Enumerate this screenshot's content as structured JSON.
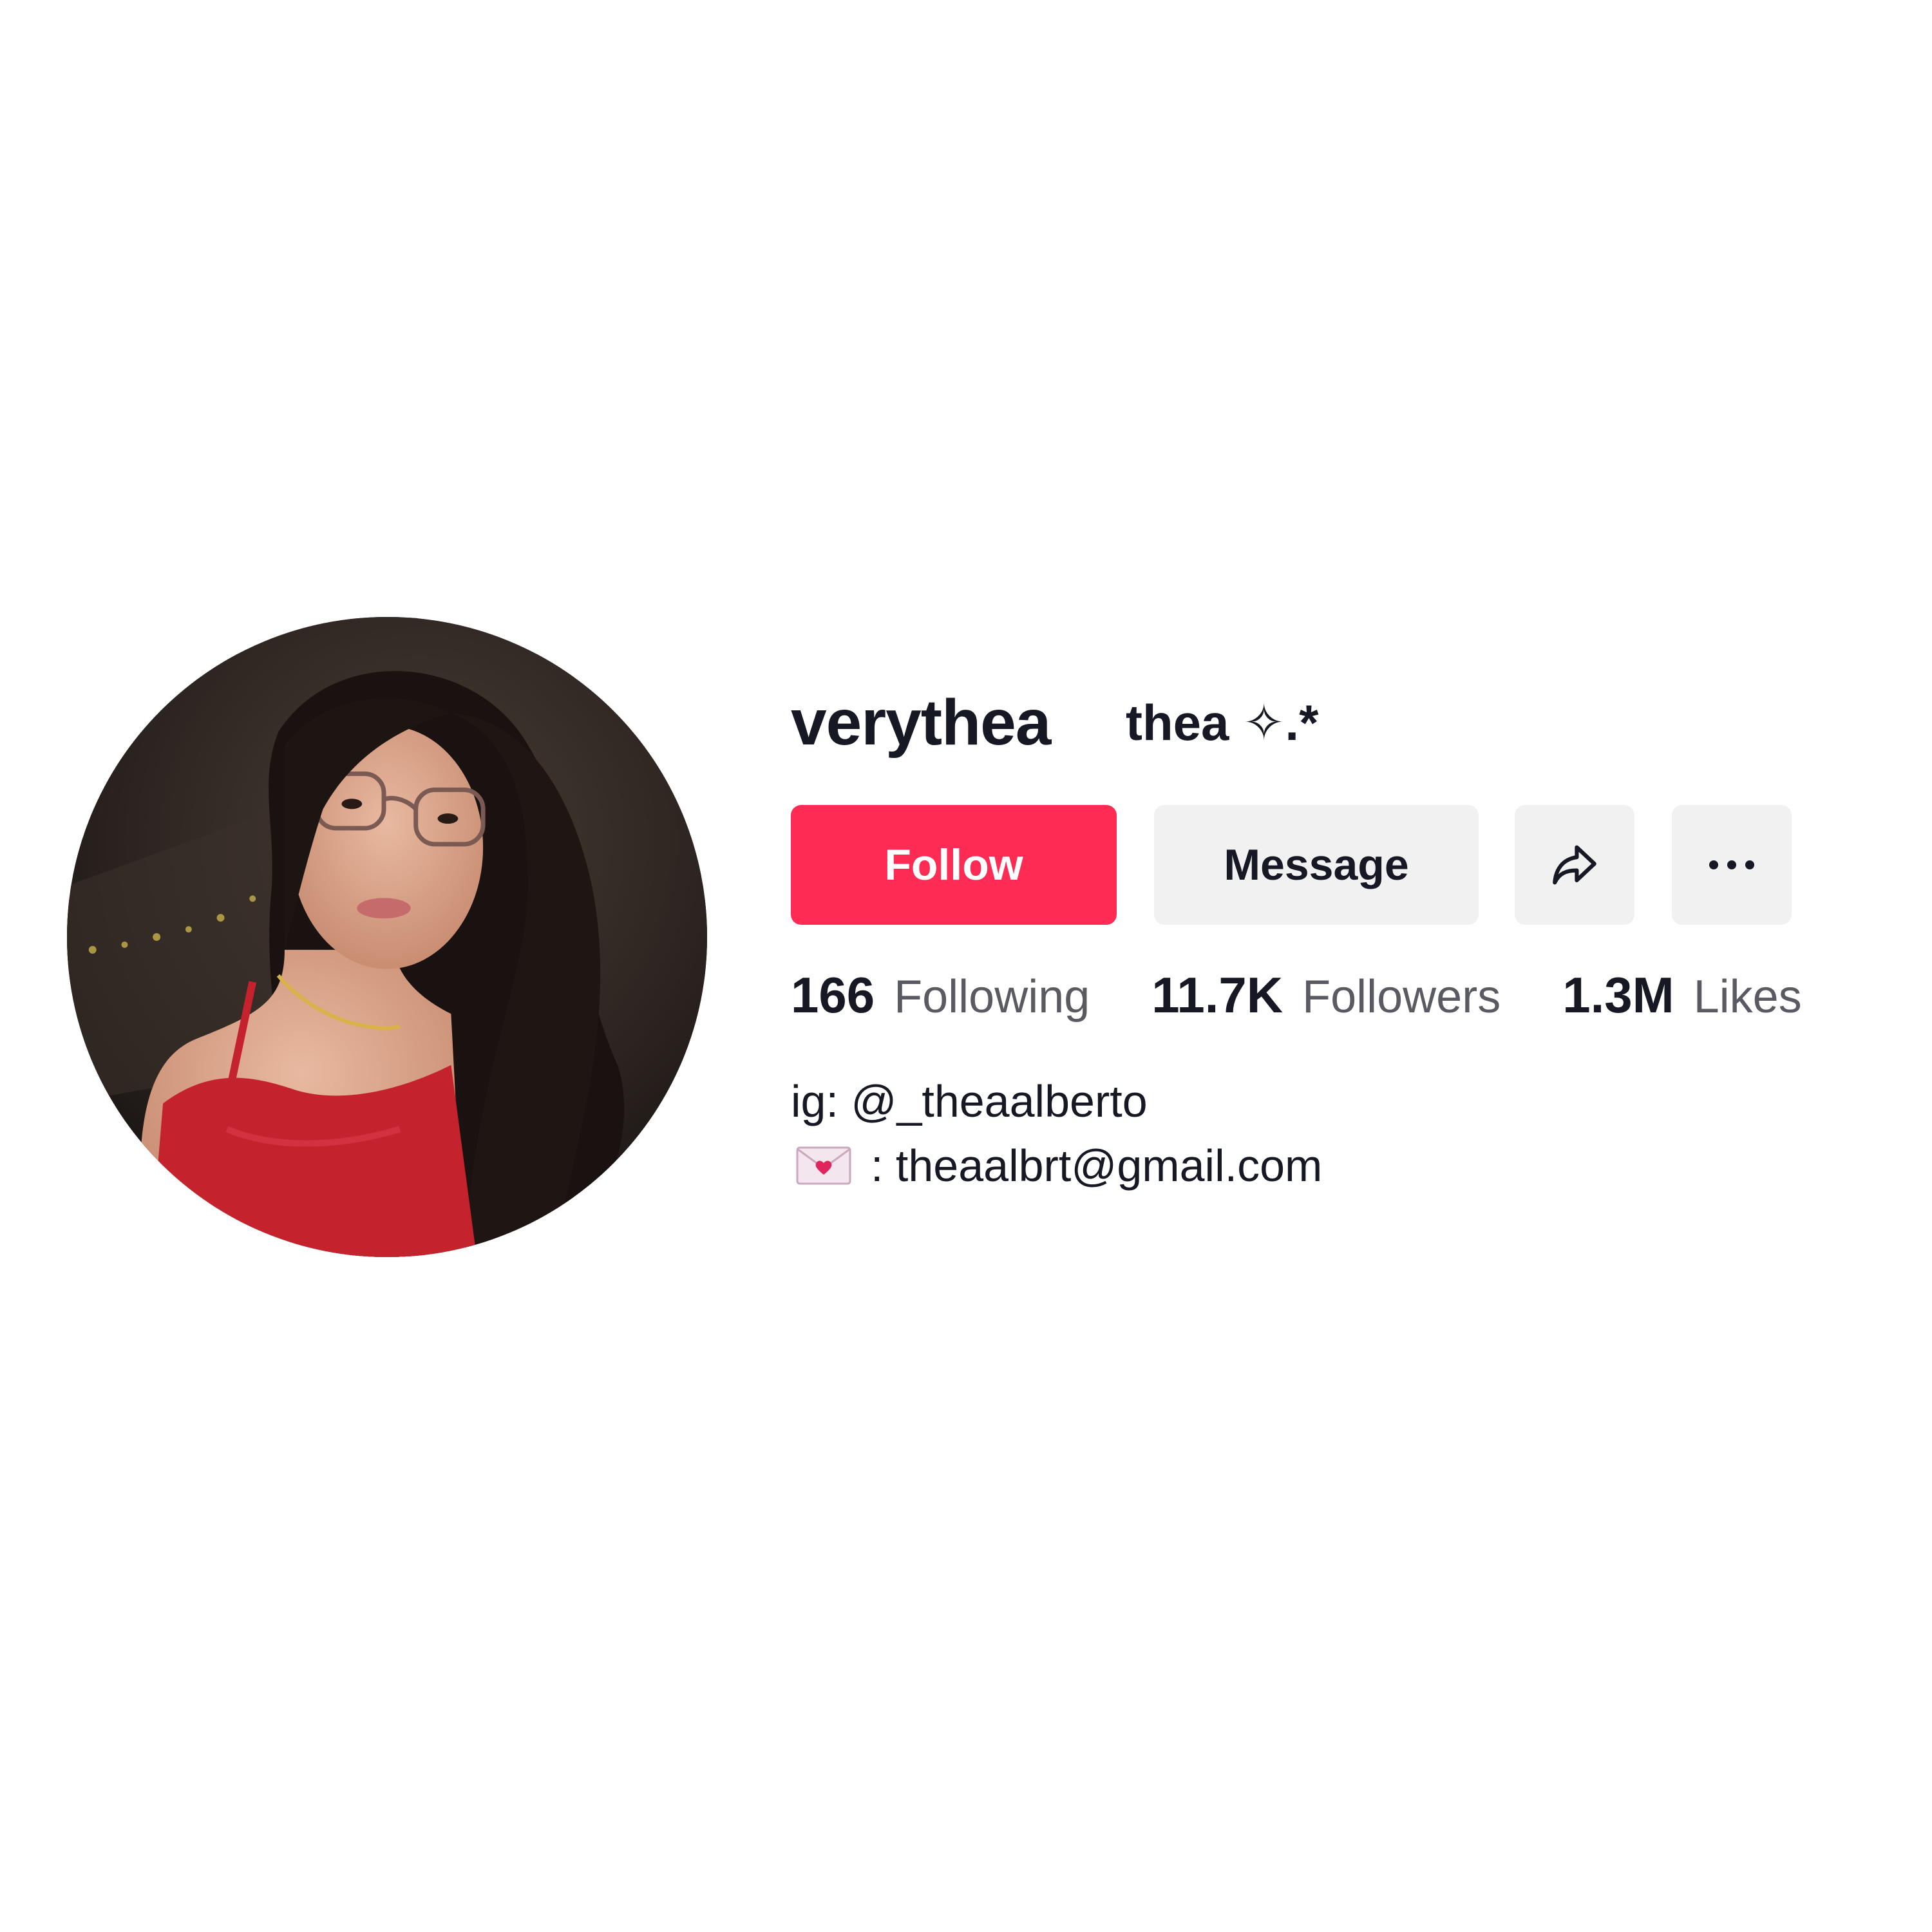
{
  "profile": {
    "username": "verythea",
    "nickname": "thea ✧.*",
    "avatar_alt": "profile photo"
  },
  "actions": {
    "follow_label": "Follow",
    "message_label": "Message",
    "share_icon": "share-arrow-icon",
    "more_icon": "more-dots-icon"
  },
  "stats": {
    "following": {
      "count": "166",
      "label": "Following"
    },
    "followers": {
      "count": "11.7K",
      "label": "Followers"
    },
    "likes": {
      "count": "1.3M",
      "label": "Likes"
    }
  },
  "bio": {
    "line1": "ig: @_theaalberto",
    "line2_icon": "love-letter-icon",
    "line2": ": theaalbrt@gmail.com"
  },
  "colors": {
    "follow_bg": "#fe2c55",
    "secondary_bg": "#f1f1f2",
    "text_primary": "#161823",
    "text_secondary": "#5a5b62"
  }
}
